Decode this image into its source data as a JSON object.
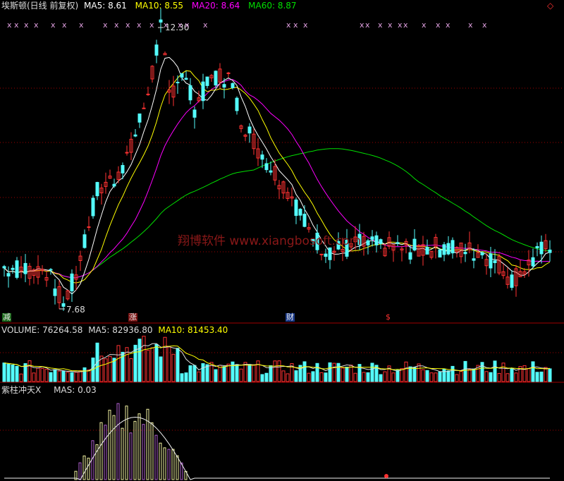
{
  "header": {
    "name": "埃斯顿(日线 前复权)",
    "ma5": "MA5: 8.61",
    "ma10": "MA10: 8.55",
    "ma20": "MA20: 8.64",
    "ma60": "MA60: 8.87"
  },
  "price_panel": {
    "high_label": "12.30",
    "low_label": "7.68",
    "watermark": "翔博软件 www.xiangbosoft.com",
    "tags": {
      "jian": "减",
      "zhang": "涨",
      "cai": "财",
      "dollar": "$"
    },
    "x_marker": "x"
  },
  "volume_panel": {
    "volume": "VOLUME: 76264.58",
    "ma5": "MA5: 82936.80",
    "ma10": "MA10: 81453.40"
  },
  "indicator_panel": {
    "name": "紫柱冲天X",
    "mas": "MAS: 0.03"
  },
  "corner": {
    "close_symbol": "◇"
  },
  "colors": {
    "up": "#ff3232",
    "down": "#54fcfc",
    "ma5": "#ffffff",
    "ma10": "#ffff00",
    "ma20": "#ff00ff",
    "ma60": "#00e000",
    "divider": "#a00000",
    "marker": "#e060e0"
  },
  "chart_data": {
    "type": "candlestick",
    "price_range": [
      7.68,
      12.3
    ],
    "high": 12.3,
    "low": 7.68,
    "ma_last": {
      "MA5": 8.61,
      "MA10": 8.55,
      "MA20": 8.64,
      "MA60": 8.87
    },
    "volume_last": 76264.58,
    "volume_ma_last": {
      "MA5": 82936.8,
      "MA10": 81453.4
    },
    "indicator_last": {
      "MAS": 0.03
    }
  }
}
